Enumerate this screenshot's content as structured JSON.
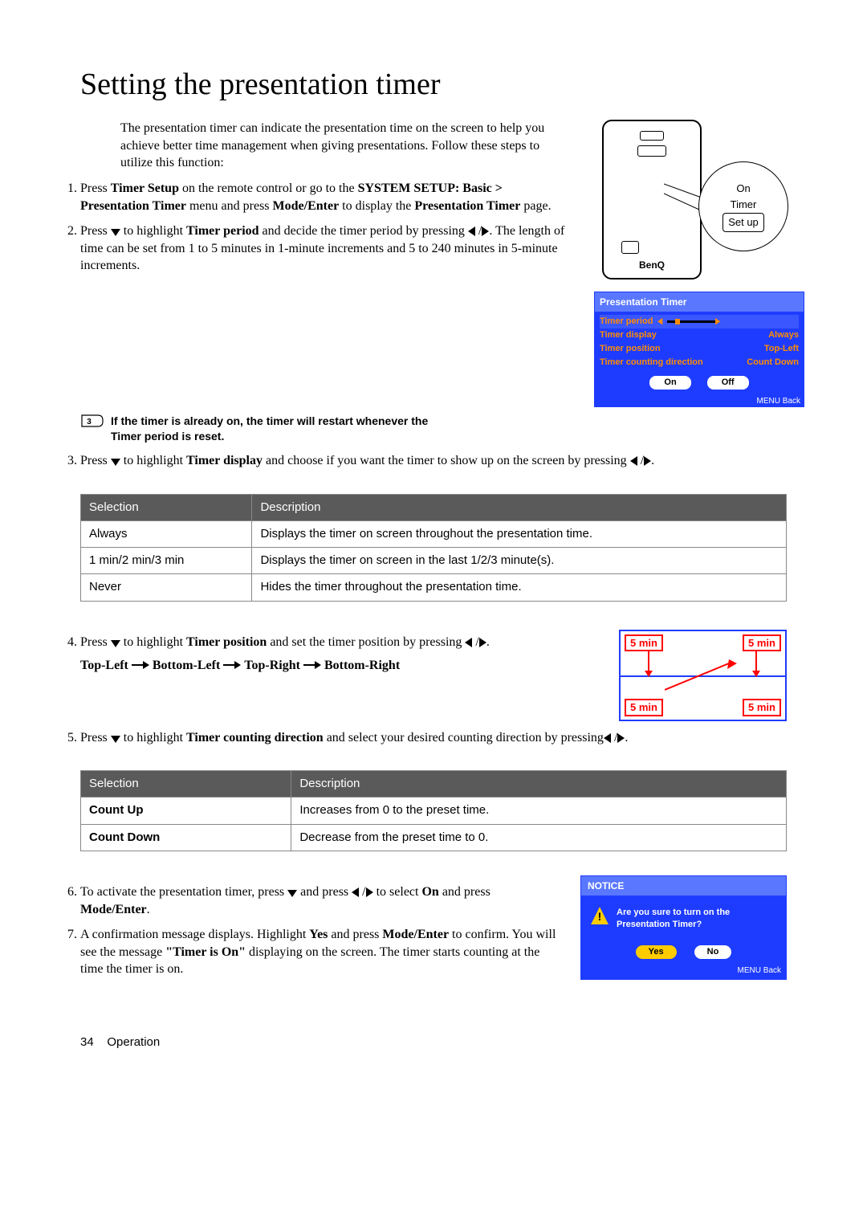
{
  "title": "Setting the presentation timer",
  "intro": "The presentation timer can indicate the presentation time on the screen to help you achieve better time management when giving presentations. Follow these steps to utilize this function:",
  "step1": {
    "pre": "Press ",
    "timer_setup": "Timer Setup",
    "mid1": " on the remote control or go to the ",
    "menu_path": "SYSTEM SETUP: Basic > Presentation Timer",
    "mid2": " menu and press ",
    "mode_enter": "Mode/Enter",
    "mid3": " to display the ",
    "page": "Presentation Timer",
    "post": " page."
  },
  "step2": {
    "pre": "Press ",
    "mid1": " to highlight ",
    "timer_period": "Timer period",
    "mid2": " and decide the timer period by pressing ",
    "post": ". The length of time can be set from 1 to 5 minutes in 1-minute increments and 5 to 240 minutes in 5-minute increments."
  },
  "note": "If the timer is already on, the timer will restart whenever the Timer period is reset.",
  "step3": {
    "pre": "Press ",
    "mid1": " to highlight ",
    "timer_display": "Timer display",
    "mid2": " and choose if you want the timer to show up on the screen by pressing ",
    "post": "."
  },
  "table1": {
    "headers": [
      "Selection",
      "Description"
    ],
    "rows": [
      [
        "Always",
        "Displays the timer on screen throughout the presentation time."
      ],
      [
        "1 min/2 min/3 min",
        "Displays the timer on screen in the last 1/2/3 minute(s)."
      ],
      [
        "Never",
        "Hides the timer throughout the presentation time."
      ]
    ]
  },
  "step4": {
    "pre": "Press ",
    "mid1": " to highlight ",
    "timer_position": "Timer position",
    "mid2": " and set the timer position by pressing ",
    "post": ".",
    "sequence": {
      "tl": "Top-Left",
      "bl": "Bottom-Left",
      "tr": "Top-Right",
      "br": "Bottom-Right"
    }
  },
  "step5": {
    "pre": "Press ",
    "mid1": " to highlight ",
    "tcd": "Timer counting direction",
    "mid2": " and select your desired counting direction by pressing",
    "post": "."
  },
  "table2": {
    "headers": [
      "Selection",
      "Description"
    ],
    "rows": [
      [
        "Count Up",
        "Increases from 0 to the preset time."
      ],
      [
        "Count Down",
        "Decrease from the preset time to 0."
      ]
    ]
  },
  "step6": {
    "pre": "To activate the presentation timer, press ",
    "mid1": " and press ",
    "mid2": " to select ",
    "on": "On",
    "mid3": " and press ",
    "mode_enter": "Mode/Enter",
    "post": "."
  },
  "step7": {
    "pre": "A confirmation message displays. Highlight ",
    "yes": "Yes",
    "mid1": " and press ",
    "mode_enter": "Mode/Enter",
    "mid2": " to confirm. You will see the message ",
    "timer_is_on": "\"Timer is On\"",
    "post": " displaying on the screen. The timer starts counting at the time the timer is on."
  },
  "remote": {
    "brand": "BenQ",
    "callout_on": "On",
    "callout_timer": "Timer",
    "callout_setup": "Set up"
  },
  "osd": {
    "title": "Presentation Timer",
    "rows": [
      {
        "k": "Timer period",
        "v": ""
      },
      {
        "k": "Timer display",
        "v": "Always"
      },
      {
        "k": "Timer position",
        "v": "Top-Left"
      },
      {
        "k": "Timer counting direction",
        "v": "Count Down"
      }
    ],
    "btn_on": "On",
    "btn_off": "Off",
    "menu_back": "MENU Back"
  },
  "position_badge": "5 min",
  "notice": {
    "title": "NOTICE",
    "msg": "Are you sure to turn on the Presentation Timer?",
    "yes": "Yes",
    "no": "No",
    "menu_back": "MENU Back"
  },
  "footer_page": "34",
  "footer_section": "Operation"
}
